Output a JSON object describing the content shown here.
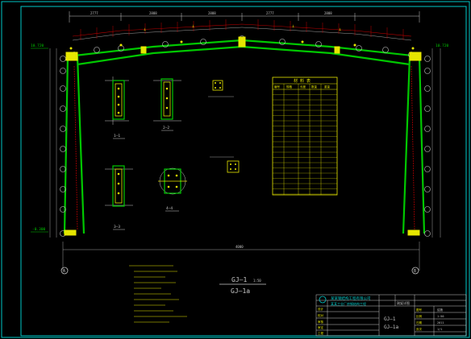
{
  "drawing": {
    "top_dimensions": [
      "2777",
      "2888",
      "2888",
      "2777",
      "2888"
    ],
    "elevation_left": "10.720",
    "elevation_left_bottom": "-0.300",
    "elevation_right": "10.720",
    "overall_dimension": "4000",
    "grid_left": "A",
    "grid_right": "B"
  },
  "sections": {
    "s1": "1—1",
    "s2": "2—2",
    "s3": "3—3",
    "s4": "4—4"
  },
  "table": {
    "title": "材  料  表",
    "headers": [
      "编号",
      "规格",
      "长度",
      "数量",
      "重量"
    ]
  },
  "titles": {
    "main": "GJ—1",
    "scale": "1:50",
    "sub": "GJ—1a"
  },
  "title_block": {
    "company": "某某钢结构工程有限公司",
    "project": "某某工业厂房钢结构工程",
    "drawing_name": "刚架详图",
    "drawing_no_1": "GJ—1",
    "drawing_no_2": "GJ—1a",
    "labels": [
      "设计",
      "校对",
      "审核",
      "审定",
      "工程",
      "子项"
    ],
    "right_labels": [
      "图号",
      "比例",
      "日期",
      "页次"
    ],
    "right_values": [
      "结施",
      "1:50",
      "2011",
      "1/1"
    ]
  },
  "colors": {
    "frame": "#00c800",
    "border": "#00c8c8",
    "dim": "#c8c8c8",
    "red": "#c00000",
    "table": "#e6e600",
    "yellow": "#e6e600"
  }
}
